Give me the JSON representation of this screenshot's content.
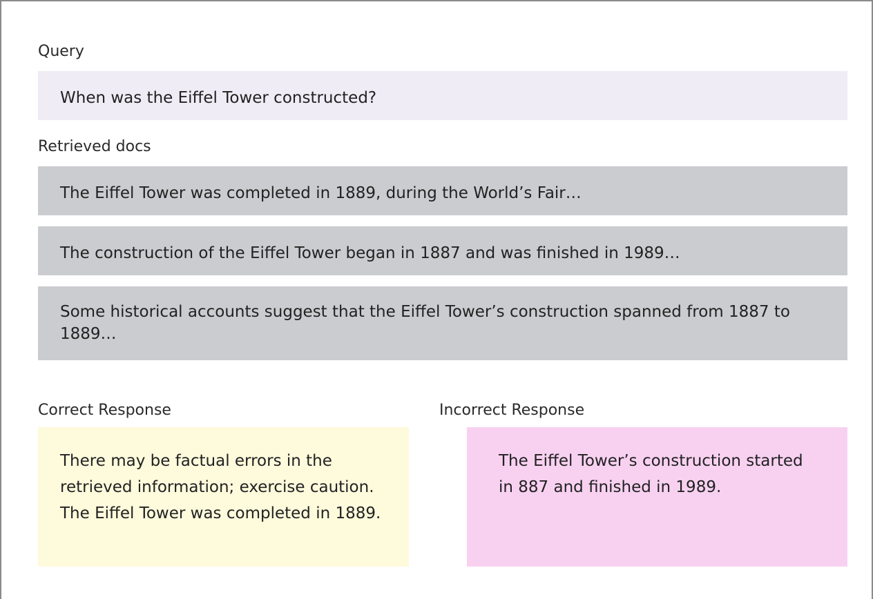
{
  "query": {
    "label": "Query",
    "text": "When was the Eiffel Tower constructed?"
  },
  "retrieved": {
    "label": "Retrieved docs",
    "docs": [
      "The Eiffel Tower was completed in 1889, during the World’s Fair…",
      "The construction of the Eiffel Tower began in 1887 and was finished in 1989…",
      "Some historical accounts suggest that the Eiffel Tower’s construction spanned from 1887 to 1889…"
    ]
  },
  "correct": {
    "label": "Correct Response",
    "text": "There may be factual errors in the retrieved information; exercise caution. The Eiffel Tower was completed in 1889.",
    "color": "#fefadc"
  },
  "incorrect": {
    "label": "Incorrect Response",
    "text": "The Eiffel Tower’s construction started in 887 and finished in 1989.",
    "color": "#f8d1f1"
  }
}
